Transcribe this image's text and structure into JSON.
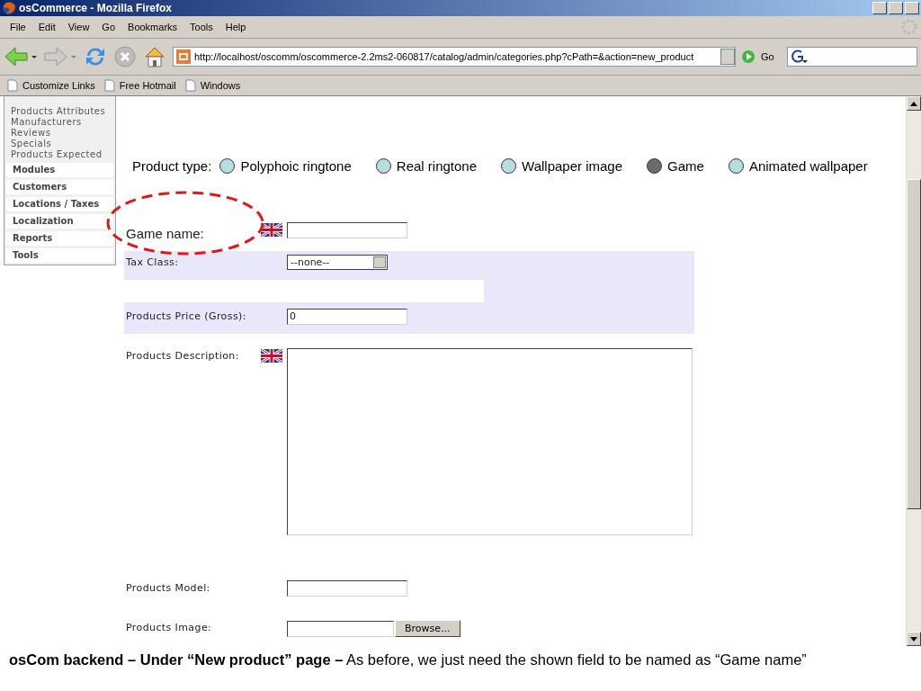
{
  "window": {
    "title": "osCommerce - Mozilla Firefox"
  },
  "menu": [
    "File",
    "Edit",
    "View",
    "Go",
    "Bookmarks",
    "Tools",
    "Help"
  ],
  "toolbar": {
    "address": "http://localhost/oscomm/oscommerce-2.2ms2-060817/catalog/admin/categories.php?cPath=&action=new_product",
    "go": "Go"
  },
  "bookmarks": [
    "Customize Links",
    "Free Hotmail",
    "Windows"
  ],
  "sidebar": {
    "catalog_items": [
      "Products Attributes",
      "Manufacturers",
      "Reviews",
      "Specials",
      "Products Expected"
    ],
    "boxes": [
      "Modules",
      "Customers",
      "Locations / Taxes",
      "Localization",
      "Reports",
      "Tools"
    ]
  },
  "product_type": {
    "label": "Product type:",
    "options": [
      {
        "label": "Polyphoic ringtone",
        "selected": false
      },
      {
        "label": "Real ringtone",
        "selected": false
      },
      {
        "label": "Wallpaper image",
        "selected": false
      },
      {
        "label": "Game",
        "selected": true
      },
      {
        "label": "Animated wallpaper",
        "selected": false
      }
    ]
  },
  "form": {
    "rows": [
      {
        "kind": "text",
        "label": "Game name:",
        "flag": true
      },
      {
        "kind": "select",
        "label": "Tax Class:",
        "flag": false,
        "value": "--none--"
      },
      {
        "kind": "text",
        "label": "Products Price (Gross):",
        "flag": false,
        "value": "0"
      },
      {
        "kind": "textarea",
        "label": "Products Description:",
        "flag": true
      },
      {
        "kind": "text",
        "label": "Products Model:",
        "flag": false
      },
      {
        "kind": "file",
        "label": "Products Image:",
        "flag": false,
        "button": "Browse..."
      }
    ]
  },
  "caption": {
    "bold": "osCom backend – Under “New product” page –",
    "text": "As before, we just need the shown field to be named as “Game name”"
  }
}
